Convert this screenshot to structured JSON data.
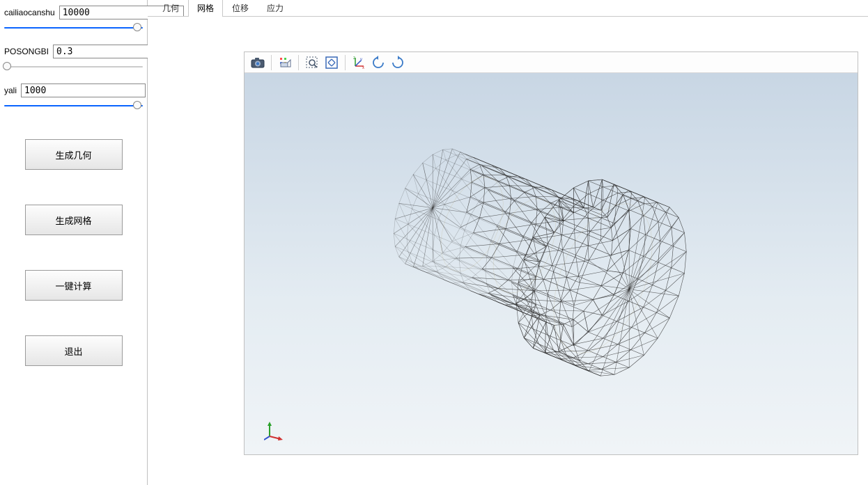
{
  "sidebar": {
    "params": [
      {
        "label": "cailiaocanshu",
        "value": "10000",
        "thumb_pct": 96
      },
      {
        "label": "POSONGBI",
        "value": "0.3",
        "thumb_pct": 2
      },
      {
        "label": "yali",
        "value": "1000",
        "thumb_pct": 96
      }
    ],
    "buttons": {
      "gen_geom": "生成几何",
      "gen_mesh": "生成网格",
      "compute": "一键计算",
      "exit": "退出"
    }
  },
  "tabs": {
    "items": [
      "几何",
      "网格",
      "位移",
      "应力"
    ],
    "active_index": 1
  },
  "viewer_tools": {
    "camera": "camera-icon",
    "persp": "perspective-box-icon",
    "zoombox": "zoom-box-icon",
    "fit": "zoom-fit-icon",
    "axes": "axes-icon",
    "rot_ccw": "rotate-ccw-icon",
    "rot_cw": "rotate-cw-icon"
  }
}
